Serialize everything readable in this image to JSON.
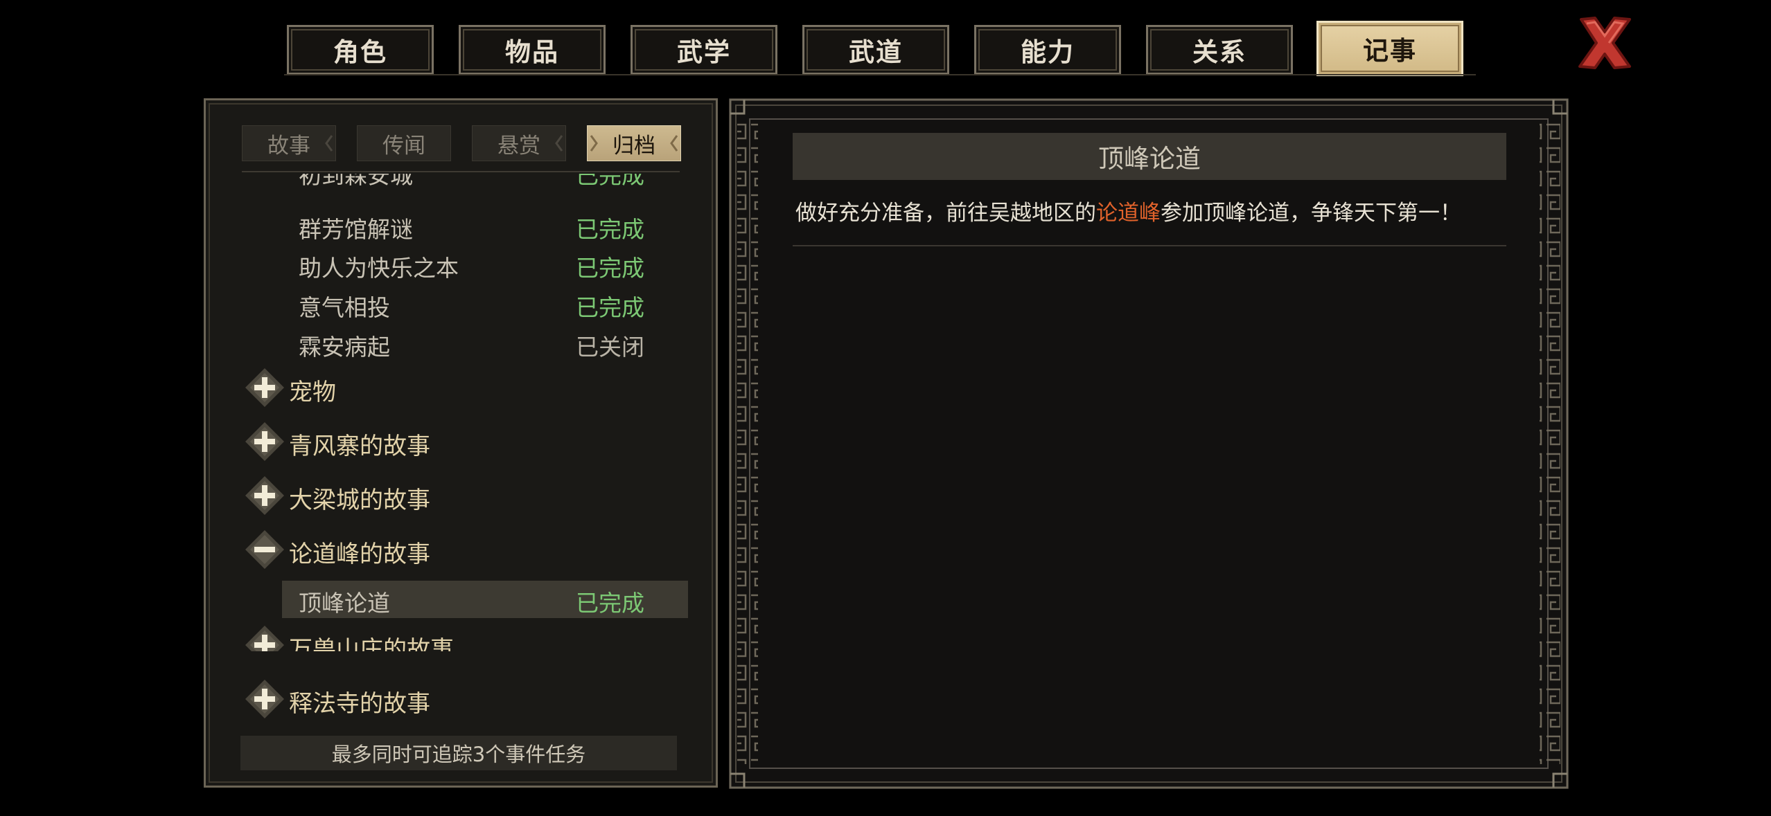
{
  "tabs": [
    {
      "label": "角色",
      "active": false
    },
    {
      "label": "物品",
      "active": false
    },
    {
      "label": "武学",
      "active": false
    },
    {
      "label": "武道",
      "active": false
    },
    {
      "label": "能力",
      "active": false
    },
    {
      "label": "关系",
      "active": false
    },
    {
      "label": "记事",
      "active": true
    }
  ],
  "close_icon": "close-x-icon",
  "subtabs": [
    {
      "label": "故事",
      "active": false
    },
    {
      "label": "传闻",
      "active": false
    },
    {
      "label": "悬赏",
      "active": false
    },
    {
      "label": "归档",
      "active": true
    }
  ],
  "quests": [
    {
      "name": "初到霖安城",
      "status": "已完成"
    },
    {
      "name": "群芳馆解谜",
      "status": "已完成"
    },
    {
      "name": "助人为快乐之本",
      "status": "已完成"
    },
    {
      "name": "意气相投",
      "status": "已完成"
    },
    {
      "name": "霖安病起",
      "status": "已关闭"
    }
  ],
  "groups": [
    {
      "label": "宠物",
      "icon": "plus-icon"
    },
    {
      "label": "青风寨的故事",
      "icon": "plus-icon"
    },
    {
      "label": "大梁城的故事",
      "icon": "plus-icon"
    },
    {
      "label": "论道峰的故事",
      "icon": "minus-icon"
    },
    {
      "label": "万兽山庄的故事",
      "icon": "plus-icon"
    },
    {
      "label": "释法寺的故事",
      "icon": "plus-icon"
    }
  ],
  "selected_quest": {
    "name": "顶峰论道",
    "status": "已完成",
    "pointer_icon": "pointing-hand-icon"
  },
  "track_note": "最多同时可追踪3个事件任务",
  "detail": {
    "title": "顶峰论道",
    "desc_before": "做好充分准备，前往吴越地区的",
    "desc_highlight": "论道峰",
    "desc_after": "参加顶峰论道，争锋天下第一！"
  },
  "colors": {
    "completed": "#7cc874",
    "closed": "#b9b3a6",
    "highlight": "#e0622b",
    "active_tab": "#d9c397",
    "group_label": "#e3d3aa"
  }
}
